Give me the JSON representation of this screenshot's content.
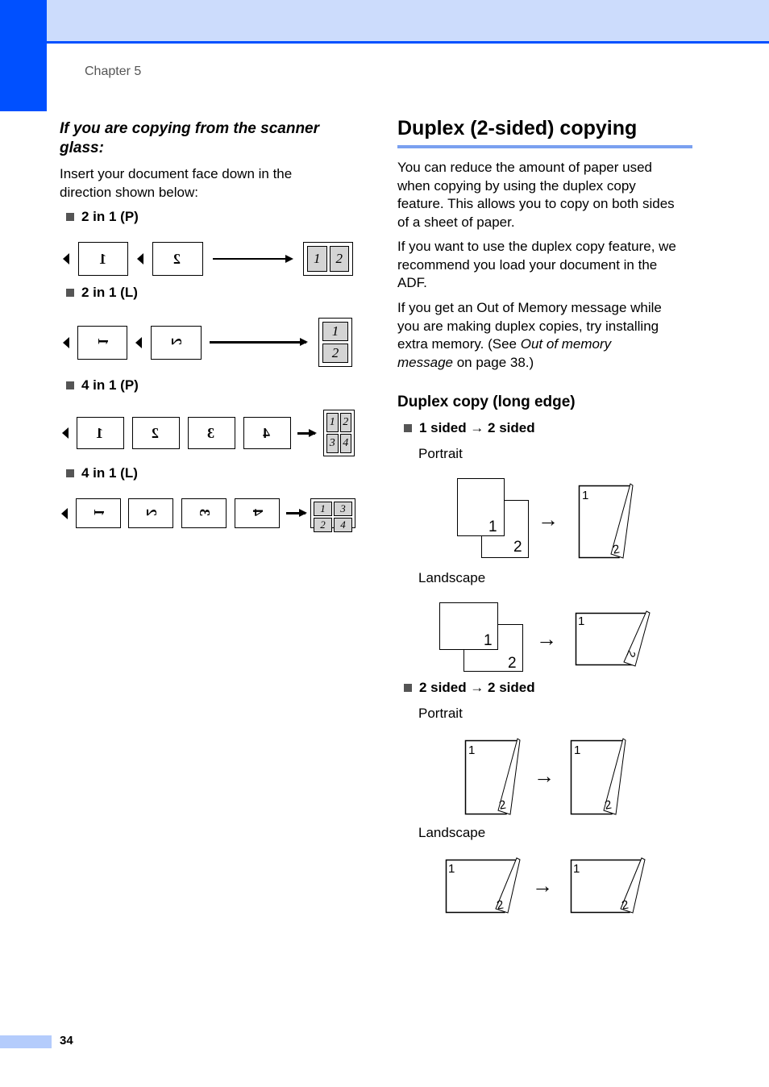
{
  "header": {
    "chapter": "Chapter 5"
  },
  "footer": {
    "page_number": "34"
  },
  "left": {
    "heading": "If you are copying from the scanner glass:",
    "heading_line1": "If you are copying from the scanner",
    "heading_line2": "glass:",
    "intro_line1": "Insert your document face down in the",
    "intro_line2": "direction shown below:",
    "layouts": [
      {
        "label": "2 in 1 (P)",
        "inputs": [
          "1",
          "2"
        ],
        "output_cells": [
          "1",
          "2"
        ]
      },
      {
        "label": "2 in 1 (L)",
        "inputs": [
          "1",
          "2"
        ],
        "output_cells": [
          "1",
          "2"
        ]
      },
      {
        "label": "4 in 1 (P)",
        "inputs": [
          "1",
          "2",
          "3",
          "4"
        ],
        "output_cells": [
          "1",
          "2",
          "3",
          "4"
        ]
      },
      {
        "label": "4 in 1 (L)",
        "inputs": [
          "1",
          "2",
          "3",
          "4"
        ],
        "output_cells": [
          "1",
          "3",
          "2",
          "4"
        ]
      }
    ]
  },
  "right": {
    "title": "Duplex (2-sided) copying",
    "para1": [
      "You can reduce the amount of paper used",
      "when copying by using the duplex copy",
      "feature. This allows you to copy on both sides",
      "of a sheet of paper."
    ],
    "para2": [
      "If you want to use the duplex copy feature, we",
      "recommend you load your document in the",
      "ADF."
    ],
    "para3_l1": "If you get an Out of Memory message while",
    "para3_l2": "you are making duplex copies, try installing",
    "para3_l3a": "extra memory. (See ",
    "para3_l3b": "Out of memory",
    "para3_l4a": "message",
    "para3_l4b": " on page 38.)",
    "subtitle": "Duplex copy (long edge)",
    "modes": [
      {
        "label": "1 sided → 2 sided",
        "portrait": "Portrait",
        "landscape": "Landscape"
      },
      {
        "label": "2 sided → 2 sided",
        "portrait": "Portrait",
        "landscape": "Landscape"
      }
    ],
    "page_digits": {
      "one": "1",
      "two": "2"
    }
  }
}
